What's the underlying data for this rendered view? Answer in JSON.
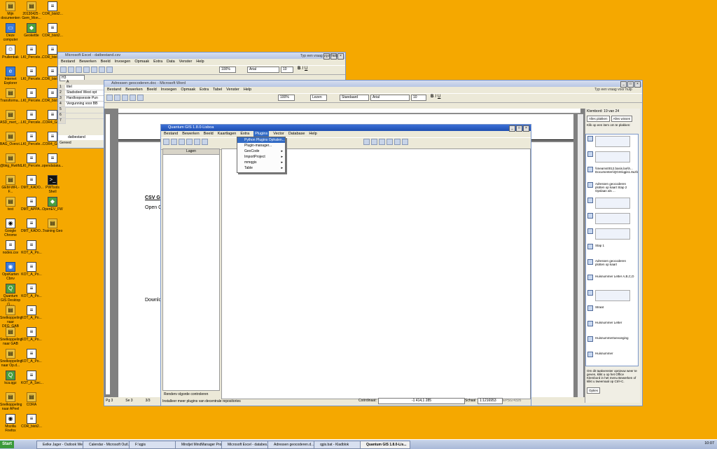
{
  "desktop": {
    "icons": [
      {
        "label": "Mijn documenten",
        "glyph": "▤",
        "cls": "folder"
      },
      {
        "label": "20130425 - Gem_Mon...",
        "glyph": "▤",
        "cls": "folder"
      },
      {
        "label": "COR_bisti2...",
        "glyph": "≡",
        "cls": ""
      },
      {
        "label": "Deze computer",
        "glyph": "▭",
        "cls": "blue"
      },
      {
        "label": "Geokettle",
        "glyph": "◆",
        "cls": "green"
      },
      {
        "label": "COR_bisti2...",
        "glyph": "≡",
        "cls": ""
      },
      {
        "label": "Prullenbak",
        "glyph": "♲",
        "cls": ""
      },
      {
        "label": "LKI_Percele...",
        "glyph": "≡",
        "cls": ""
      },
      {
        "label": "COR_bisti2...",
        "glyph": "≡",
        "cls": ""
      },
      {
        "label": "Internet Explorer",
        "glyph": "e",
        "cls": "blue"
      },
      {
        "label": "LKI_Percele...",
        "glyph": "≡",
        "cls": ""
      },
      {
        "label": "COR_bisti2...",
        "glyph": "≡",
        "cls": ""
      },
      {
        "label": "Transforma...",
        "glyph": "▤",
        "cls": "folder"
      },
      {
        "label": "LKI_Percele...",
        "glyph": "≡",
        "cls": ""
      },
      {
        "label": "COR_bisti2...",
        "glyph": "≡",
        "cls": ""
      },
      {
        "label": "ASD_mert_...",
        "glyph": "▤",
        "cls": "folder"
      },
      {
        "label": "LKI_Percele...",
        "glyph": "≡",
        "cls": ""
      },
      {
        "label": "COR4_GR...",
        "glyph": "≡",
        "cls": ""
      },
      {
        "label": "BAG_Overzi...",
        "glyph": "▤",
        "cls": "folder"
      },
      {
        "label": "LKI_Percele...",
        "glyph": "≡",
        "cls": ""
      },
      {
        "label": "COR4_GR...",
        "glyph": "≡",
        "cls": ""
      },
      {
        "label": "@bkg_Rwitfd...",
        "glyph": "▤",
        "cls": "folder"
      },
      {
        "label": "LKI_Percele...",
        "glyph": "≡",
        "cls": ""
      },
      {
        "label": "opendataka...",
        "glyph": "≡",
        "cls": ""
      },
      {
        "label": "GEM-WFL-F...",
        "glyph": "▤",
        "cls": "folder"
      },
      {
        "label": "DMT_KADO...",
        "glyph": "≡",
        "cls": ""
      },
      {
        "label": "PWTools Shell",
        "glyph": ">_",
        "cls": "black"
      },
      {
        "label": "test",
        "glyph": "▤",
        "cls": "folder"
      },
      {
        "label": "DMT_APPA...",
        "glyph": "≡",
        "cls": ""
      },
      {
        "label": "OpenEV_FW",
        "glyph": "◆",
        "cls": "green"
      },
      {
        "label": "Google Chrome",
        "glyph": "◉",
        "cls": ""
      },
      {
        "label": "DMT_KADO...",
        "glyph": "≡",
        "cls": ""
      },
      {
        "label": "Training Geo",
        "glyph": "▤",
        "cls": "folder"
      },
      {
        "label": "nodes.csv",
        "glyph": "≡",
        "cls": ""
      },
      {
        "label": "KOT_A_Po...",
        "glyph": "≡",
        "cls": ""
      },
      {
        "label": "",
        "glyph": "",
        "cls": ""
      },
      {
        "label": "OpsKarten Cbnv",
        "glyph": "◉",
        "cls": "blue"
      },
      {
        "label": "KOT_A_Po...",
        "glyph": "≡",
        "cls": ""
      },
      {
        "label": "",
        "glyph": "",
        "cls": ""
      },
      {
        "label": "Quantum GIS Desktop (1....",
        "glyph": "Q",
        "cls": "green"
      },
      {
        "label": "KOT_A_Po...",
        "glyph": "≡",
        "cls": ""
      },
      {
        "label": "",
        "glyph": "",
        "cls": ""
      },
      {
        "label": "Snelkoppeling naar DFG_GAB",
        "glyph": "▤",
        "cls": "folder"
      },
      {
        "label": "KOT_A_Po...",
        "glyph": "≡",
        "cls": ""
      },
      {
        "label": "",
        "glyph": "",
        "cls": ""
      },
      {
        "label": "Snelkoppeling naar GAB",
        "glyph": "▤",
        "cls": "folder"
      },
      {
        "label": "KOT_A_Po...",
        "glyph": "≡",
        "cls": ""
      },
      {
        "label": "",
        "glyph": "",
        "cls": ""
      },
      {
        "label": "Snelkoppeling naar Op.d...",
        "glyph": "▤",
        "cls": "folder"
      },
      {
        "label": "KOT_A_Po...",
        "glyph": "≡",
        "cls": ""
      },
      {
        "label": "",
        "glyph": "",
        "cls": ""
      },
      {
        "label": "kca.qgz",
        "glyph": "Q",
        "cls": "green"
      },
      {
        "label": "KOT_A_Sec...",
        "glyph": "≡",
        "cls": ""
      },
      {
        "label": "",
        "glyph": "",
        "cls": ""
      },
      {
        "label": "Snelkoppeling naar APeel",
        "glyph": "▤",
        "cls": "folder"
      },
      {
        "label": "CORA",
        "glyph": "▤",
        "cls": "folder"
      },
      {
        "label": "",
        "glyph": "",
        "cls": ""
      },
      {
        "label": "Mozilla Firefox",
        "glyph": "◉",
        "cls": ""
      },
      {
        "label": "COR_bisti2...",
        "glyph": "≡",
        "cls": ""
      },
      {
        "label": "",
        "glyph": "",
        "cls": ""
      }
    ]
  },
  "excel": {
    "title": "Microsoft Excel - datbestand.csv",
    "menu": [
      "Bestand",
      "Bewerken",
      "Beeld",
      "Invoegen",
      "Opmaak",
      "Extra",
      "Data",
      "Venster",
      "Help"
    ],
    "help_box": "Typ een vraag voor hulp",
    "zoom": "100%",
    "font": "Arial",
    "size": "10",
    "cell_ref": "H3",
    "col_a": "A",
    "rows": [
      {
        "num": "1",
        "a": "Id",
        "b": "titel"
      },
      {
        "num": "2",
        "a": "1",
        "b": "Stadsdeel West opt"
      },
      {
        "num": "3",
        "a": "2",
        "b": "Hardloopsessie Pun"
      },
      {
        "num": "4",
        "a": "3",
        "b": "Vergunning voor BB"
      },
      {
        "num": "5",
        "a": "",
        "b": ""
      },
      {
        "num": "6",
        "a": "",
        "b": ""
      },
      {
        "num": "7",
        "a": "",
        "b": ""
      }
    ],
    "sheet_tab": "datbestand",
    "status": "Gereed"
  },
  "word": {
    "title": "Adressen geocoderen.doc - Microsoft Word",
    "menu": [
      "Bestand",
      "Bewerken",
      "Beeld",
      "Invoegen",
      "Opmaak",
      "Extra",
      "Tabel",
      "Venster",
      "Help"
    ],
    "help_box": "Typ een vraag voor hulp",
    "zoom": "100%",
    "read_btn": "Lezen",
    "style": "Standaard",
    "font": "Arial",
    "size": "10",
    "doc_heading": "CSV G",
    "doc_line1": "Open C",
    "doc_line2": "Downlo",
    "status_page": "Pg 3",
    "status_sec": "Se 3",
    "status_pages": "3/3"
  },
  "clipboard": {
    "title": "Klembord: 19 van 24",
    "paste_all": "Alles plakken",
    "clear_all": "Alles wissen",
    "hint": "Klik op een item om te plakken:",
    "items": [
      {
        "text": ""
      },
      {
        "text": ""
      },
      {
        "text": "\\\\meams0012.basis.lan\\h... Documenten\\QGIS\\qgis1.8uzb"
      },
      {
        "text": "Adressen geocoderen plotten op kaart Stap 2 Opslaan als ..."
      },
      {
        "text": ""
      },
      {
        "text": ""
      },
      {
        "text": ""
      },
      {
        "text": "Stap 1"
      },
      {
        "text": "Adressen geocoderen plotten op kaart"
      },
      {
        "text": "Huisnummer Letter A,B,C,D"
      },
      {
        "text": ""
      },
      {
        "text": "Straat"
      },
      {
        "text": "Huisnummer Letter"
      },
      {
        "text": "Huisnummertoevoeging"
      },
      {
        "text": "Huisnummer"
      }
    ],
    "footer": "Om dit taakvenster opnieuw weer te geven, klikt u op het Office Klembord in het menu Bewerken of klikt u tweemaal op Ctrl+C.",
    "options": "Opties"
  },
  "qgis": {
    "title": "Quantum GIS 1.8.0-Lisboa",
    "menu": [
      "Bestand",
      "Bewerken",
      "Beeld",
      "Kaartlagen",
      "Extra",
      "Plugins",
      "Vector",
      "Database",
      "Help"
    ],
    "layers_title": "Lagen",
    "plugins_menu": [
      {
        "label": "Python Plugins Ophalen...",
        "sel": true,
        "sub": false
      },
      {
        "label": "Plugin-manager...",
        "sel": false,
        "sub": false
      },
      {
        "label": "GeoCode",
        "sel": false,
        "sub": true
      },
      {
        "label": "ImportProject",
        "sel": false,
        "sub": true
      },
      {
        "label": "mmqgis",
        "sel": false,
        "sub": true
      },
      {
        "label": "Table",
        "sel": false,
        "sub": true
      }
    ],
    "render_checkbox": "Renderv olgorde controleren",
    "status_text": "Installeer meer plugins van decentrale repositories",
    "coord_label": "Coördinaat:",
    "coord_value": "-1 414,1 285",
    "scale_label": "Schaal",
    "scale_value": "1:1216953",
    "epsg": "EPSG:4326"
  },
  "taskbar": {
    "start": "Start",
    "buttons": [
      {
        "label": "Eelke Jager - Outlook We...",
        "active": false
      },
      {
        "label": "Calendar - Microsoft Outl...",
        "active": false
      },
      {
        "label": "F:\\qgis",
        "active": false
      },
      {
        "label": "Mindjet MindManager Pro ...",
        "active": false
      },
      {
        "label": "Microsoft Excel - databes...",
        "active": false
      },
      {
        "label": "Adressen geocoderen.d...",
        "active": false
      },
      {
        "label": "qgis.bat - Kladblok",
        "active": false
      },
      {
        "label": "Quantum GIS 1.8.0-Lis...",
        "active": true
      }
    ],
    "clock": "10:07"
  }
}
